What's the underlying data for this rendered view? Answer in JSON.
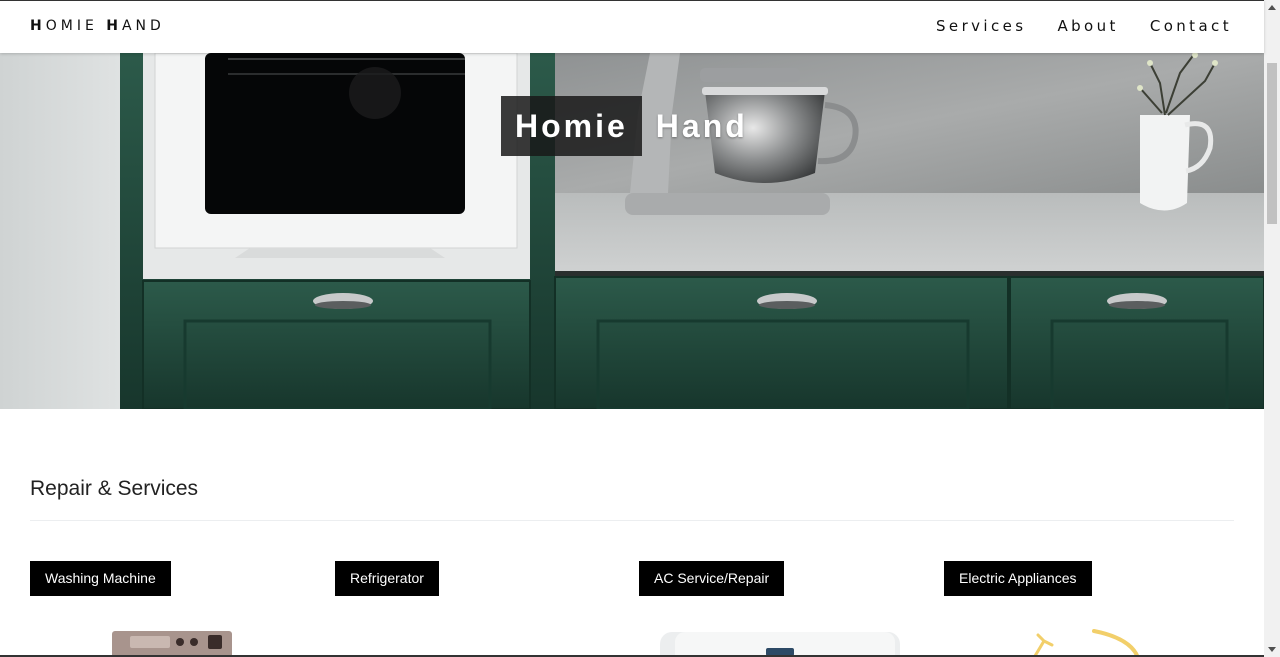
{
  "header": {
    "brand_first_initial": "H",
    "brand_first_rest": "OMIE ",
    "brand_second_initial": "H",
    "brand_second_rest": "AND",
    "nav": [
      {
        "label": "Services"
      },
      {
        "label": "About"
      },
      {
        "label": "Contact"
      }
    ]
  },
  "hero": {
    "title_word_1": "Homie",
    "title_word_2": "Hand"
  },
  "services": {
    "heading": "Repair & Services",
    "cards": [
      {
        "label": "Washing Machine",
        "icon": "washing-machine-icon"
      },
      {
        "label": "Refrigerator",
        "icon": "refrigerator-icon"
      },
      {
        "label": "AC Service/Repair",
        "icon": "air-conditioner-icon"
      },
      {
        "label": "Electric Appliances",
        "icon": "electric-appliance-icon"
      }
    ]
  },
  "colors": {
    "cabinet_green": "#22493c",
    "label_bg": "#000000",
    "label_text": "#ffffff"
  }
}
